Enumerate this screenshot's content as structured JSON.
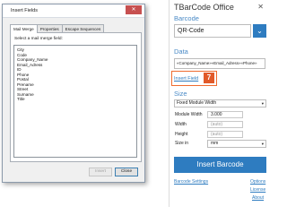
{
  "dialog": {
    "title": "Insert Fields",
    "close_glyph": "✕",
    "tabs": [
      "Mail Merge",
      "Properties",
      "Escape Sequences"
    ],
    "instruction": "Select a mail merge field:",
    "fields": [
      "City",
      "Code",
      "Company_Name",
      "Email_Adress",
      "ID",
      "Phone",
      "Postal",
      "Prename",
      "Street",
      "Surname",
      "Title"
    ],
    "insert_label": "Insert",
    "close_label": "Close"
  },
  "pane": {
    "title": "TBarCode Office",
    "close_glyph": "✕",
    "barcode_heading": "Barcode",
    "barcode_type": "QR-Code",
    "barcode_button_glyph": "⌄",
    "data_heading": "Data",
    "data_value": "«Company_Name»«Email_Adress»«Phone»",
    "insert_field_link": "Insert Field",
    "badge_number": "7",
    "size_heading": "Size",
    "size_mode": "Fixed Module Width",
    "properties": [
      {
        "label": "Module Width",
        "value": "3.000"
      },
      {
        "label": "Width",
        "value": "(auto)"
      },
      {
        "label": "Height",
        "value": "(auto)"
      }
    ],
    "size_in_label": "Size in",
    "size_in_value": "mm",
    "dropdown_glyph": "▾",
    "insert_barcode_label": "Insert Barcode",
    "links": {
      "barcode_settings": "Barcode Settings",
      "options": "Options",
      "license": "License",
      "about": "About"
    },
    "accent_color": "#2e7cc0",
    "highlight_color": "#ef6c2f"
  }
}
